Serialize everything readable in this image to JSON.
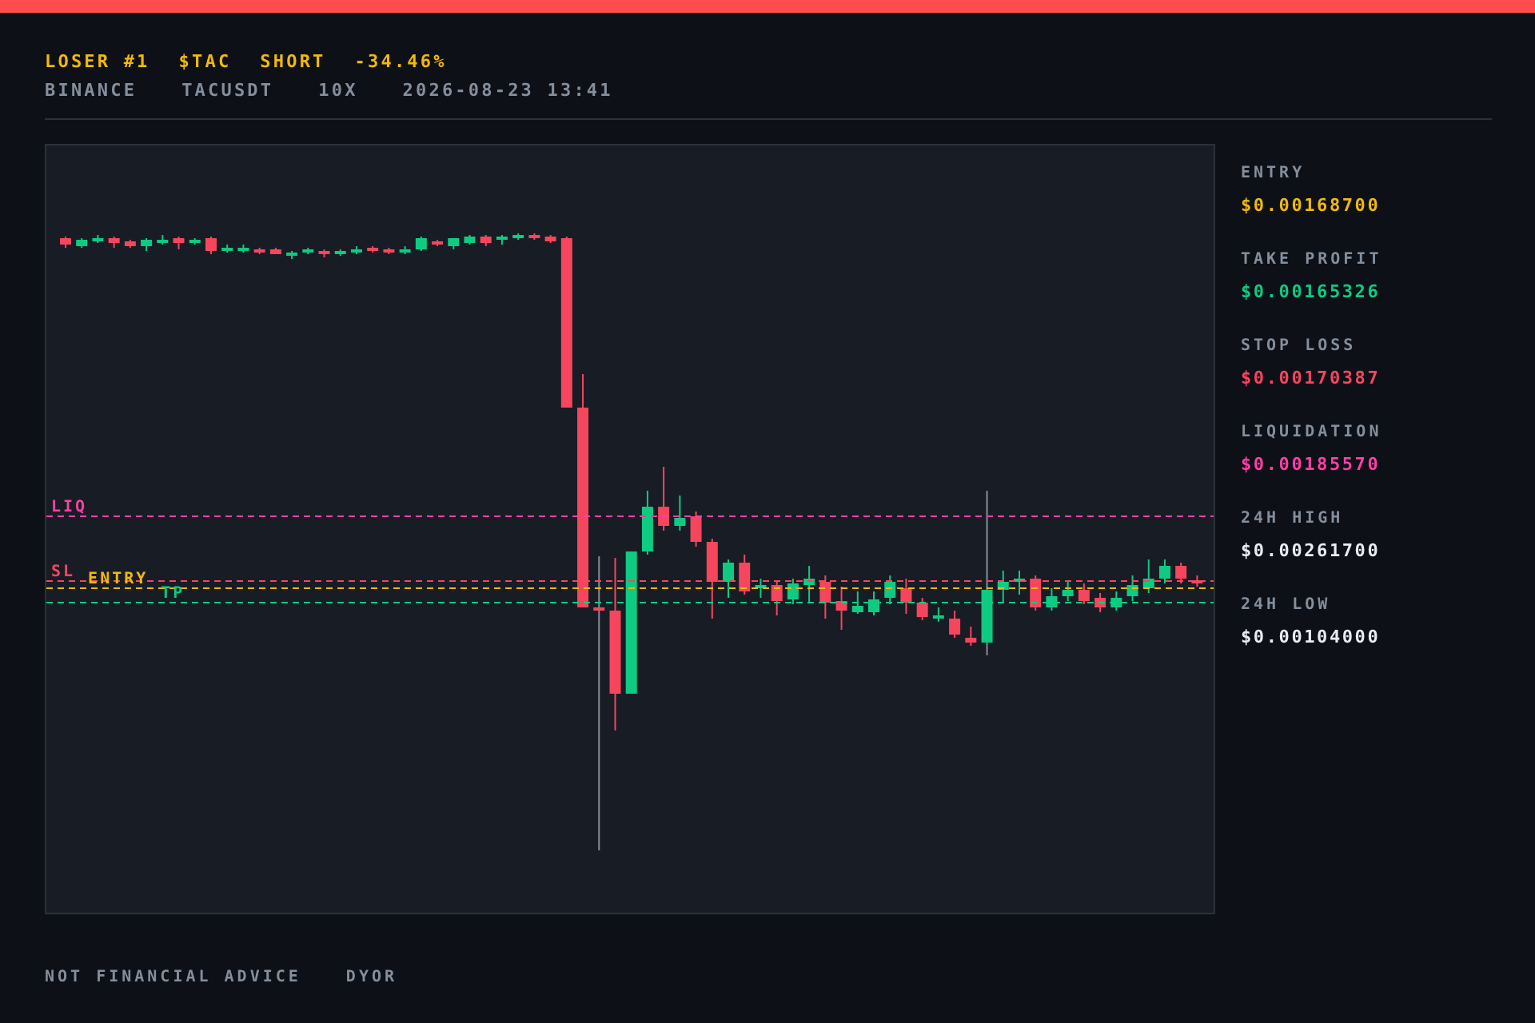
{
  "header": {
    "rank": "LOSER #1",
    "symbol": "$TAC",
    "side": "SHORT",
    "change": "-34.46%",
    "exchange": "BINANCE",
    "pair": "TACUSDT",
    "leverage": "10X",
    "timestamp": "2026-08-23 13:41"
  },
  "chart": {
    "levels": [
      {
        "kind": "liq",
        "label": "LIQ",
        "color": "#ff3fa4"
      },
      {
        "kind": "sl",
        "label": "SL",
        "color": "#f6465d"
      },
      {
        "kind": "entry",
        "label": "ENTRY",
        "color": "#f0b90b"
      },
      {
        "kind": "tp",
        "label": "TP",
        "color": "#0ecb81"
      }
    ]
  },
  "stats": [
    {
      "kind": "entry",
      "label": "ENTRY",
      "value": "$0.00168700",
      "color": "#f0b90b"
    },
    {
      "kind": "tp",
      "label": "TAKE PROFIT",
      "value": "$0.00165326",
      "color": "#0ecb81"
    },
    {
      "kind": "sl",
      "label": "STOP LOSS",
      "value": "$0.00170387",
      "color": "#f6465d"
    },
    {
      "kind": "liq",
      "label": "LIQUIDATION",
      "value": "$0.00185570",
      "color": "#ff3fa4"
    },
    {
      "kind": "high",
      "label": "24H HIGH",
      "value": "$0.00261700",
      "color": "#eaecef"
    },
    {
      "kind": "low",
      "label": "24H LOW",
      "value": "$0.00104000",
      "color": "#eaecef"
    }
  ],
  "footer": {
    "disclaimer": "NOT FINANCIAL ADVICE",
    "note": "DYOR"
  }
}
